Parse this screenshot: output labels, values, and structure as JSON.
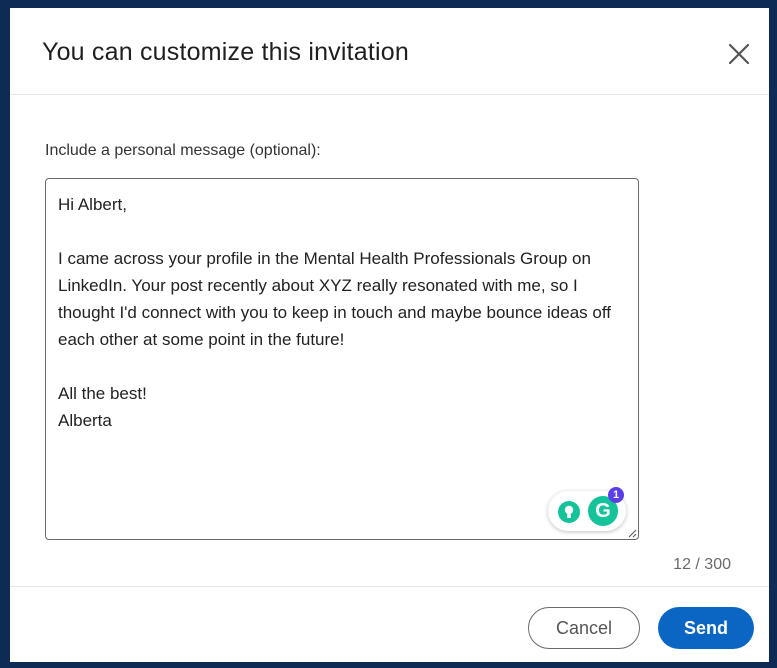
{
  "dialog": {
    "title": "You can customize this invitation",
    "close_icon": "close-icon"
  },
  "form": {
    "prompt_label": "Include a personal message (optional):",
    "message": "Hi Albert,\n\nI came across your profile in the Mental Health Professionals Group on LinkedIn. Your post recently about XYZ really resonated with me, so I thought I'd connect with you to keep in touch and maybe bounce ideas off each other at some point in the future!\n\nAll the best!\nAlberta",
    "counter": "12 / 300"
  },
  "grammarly": {
    "letter": "G",
    "badge_count": "1",
    "colors": {
      "green": "#15c39a",
      "badge": "#5b3ee8"
    }
  },
  "footer": {
    "cancel_label": "Cancel",
    "send_label": "Send"
  },
  "colors": {
    "accent": "#0a66c2",
    "background": "#0d2b55"
  }
}
